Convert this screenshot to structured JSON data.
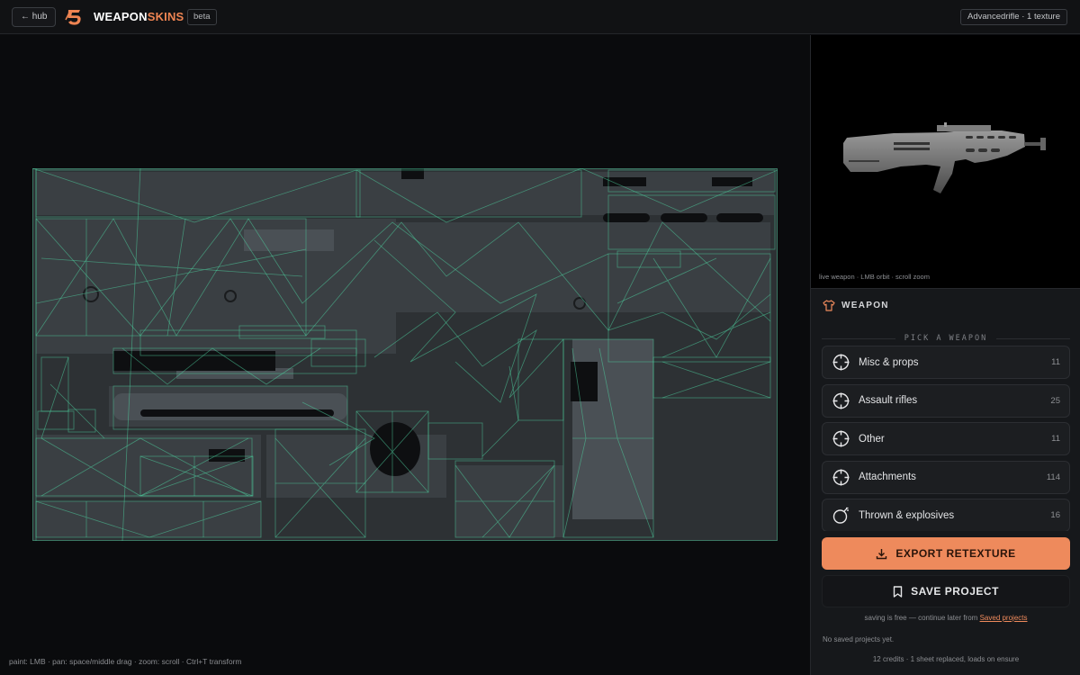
{
  "topbar": {
    "hub_label": "← hub",
    "brand_part1": "WEAPON",
    "brand_part2": "SKINS",
    "beta_label": "beta",
    "texture_info": "Advancedrifle · 1 texture"
  },
  "canvas": {
    "hint": "paint: LMB · pan: space/middle drag · zoom: scroll · Ctrl+T transform"
  },
  "viewer": {
    "hint": "live weapon · LMB orbit · scroll zoom"
  },
  "weapon_section": {
    "title": "WEAPON",
    "icon": "shirt-icon",
    "pick_label": "PICK A WEAPON",
    "categories": [
      {
        "label": "Misc & props",
        "count": "11",
        "icon": "crosshair-icon"
      },
      {
        "label": "Assault rifles",
        "count": "25",
        "icon": "crosshair-icon"
      },
      {
        "label": "Other",
        "count": "11",
        "icon": "crosshair-icon"
      },
      {
        "label": "Attachments",
        "count": "114",
        "icon": "crosshair-icon"
      },
      {
        "label": "Thrown & explosives",
        "count": "16",
        "icon": "bomb-icon"
      }
    ]
  },
  "actions": {
    "export_label": "EXPORT RETEXTURE",
    "save_label": "SAVE PROJECT",
    "saving_note": "saving is free — continue later from",
    "saved_link": "Saved projects",
    "no_saved": "No saved projects yet.",
    "credits": "12 credits · 1 sheet replaced, loads on ensure"
  },
  "colors": {
    "accent": "#ee8a5c",
    "wireframe": "#4fd1a1",
    "background": "#0b0c0e",
    "panel": "#16181b"
  }
}
